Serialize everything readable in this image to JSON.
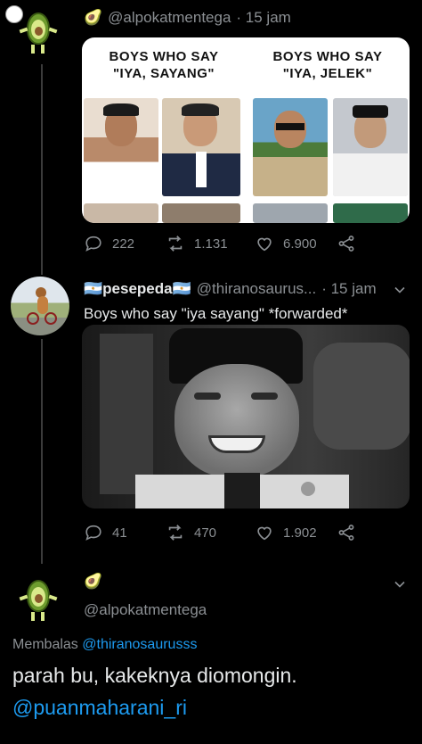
{
  "tweet1": {
    "emoji": "🥑",
    "handle": "@alpokatmentega",
    "time": "· 15 jam",
    "meme": {
      "left_caption": "BOYS WHO SAY\n\"IYA, SAYANG\"",
      "right_caption": "BOYS WHO SAY\n\"IYA, JELEK\""
    },
    "stats": {
      "replies": "222",
      "retweets": "1.131",
      "likes": "6.900"
    }
  },
  "tweet2": {
    "name": "🇦🇷pesepeda🇦🇷",
    "handle": "@thiranosaurus...",
    "time": "· 15 jam",
    "text": "Boys who say \"iya sayang\" *forwarded*",
    "stats": {
      "replies": "41",
      "retweets": "470",
      "likes": "1.902"
    }
  },
  "tweet3": {
    "emoji": "🥑",
    "handle": "@alpokatmentega",
    "reply_prefix": "Membalas",
    "reply_to": "@thiranosaurusss",
    "text": "parah bu, kakeknya diomongin.",
    "mention": "@puanmaharani_ri"
  },
  "colors": {
    "background": "#000000",
    "text_primary": "#e7e9ea",
    "text_secondary": "#8b8f93",
    "link": "#1d9bf0"
  }
}
